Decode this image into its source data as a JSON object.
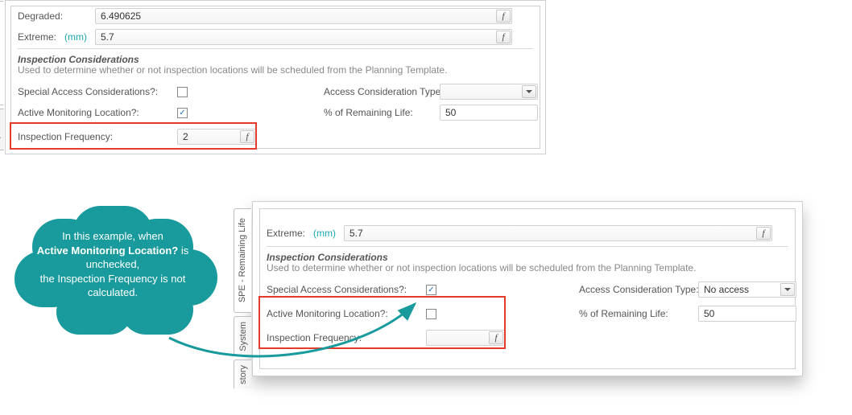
{
  "labels": {
    "degraded": "Degraded:",
    "extreme": "Extreme:",
    "mm_unit": "(mm)",
    "group_header": "Inspection Considerations",
    "group_desc": "Used to determine whether or not inspection locations will be scheduled from the Planning Template.",
    "special_access": "Special Access Considerations?:",
    "access_type": "Access Consideration Type:",
    "active_monitoring": "Active Monitoring Location?:",
    "pct_remaining": "% of Remaining Life:",
    "inspection_freq": "Inspection Frequency:",
    "f_symbol": "f"
  },
  "tabs": {
    "spe": "SPE - Remaining Life",
    "system": "System",
    "story": "story"
  },
  "panel_top": {
    "degraded_value": "6.490625",
    "extreme_value": "5.7",
    "special_access_checked": false,
    "access_type_value": "",
    "active_monitoring_checked": true,
    "pct_remaining_value": "50",
    "inspection_freq_value": "2"
  },
  "panel_bottom": {
    "extreme_value": "5.7",
    "special_access_checked": true,
    "access_type_value": "No access",
    "active_monitoring_checked": false,
    "pct_remaining_value": "50",
    "inspection_freq_value": ""
  },
  "callout": {
    "line1a": "In this example, when",
    "line1b": "Active Monitoring Location?",
    "line2": " is unchecked,",
    "line3": "the Inspection Frequency is not calculated."
  }
}
